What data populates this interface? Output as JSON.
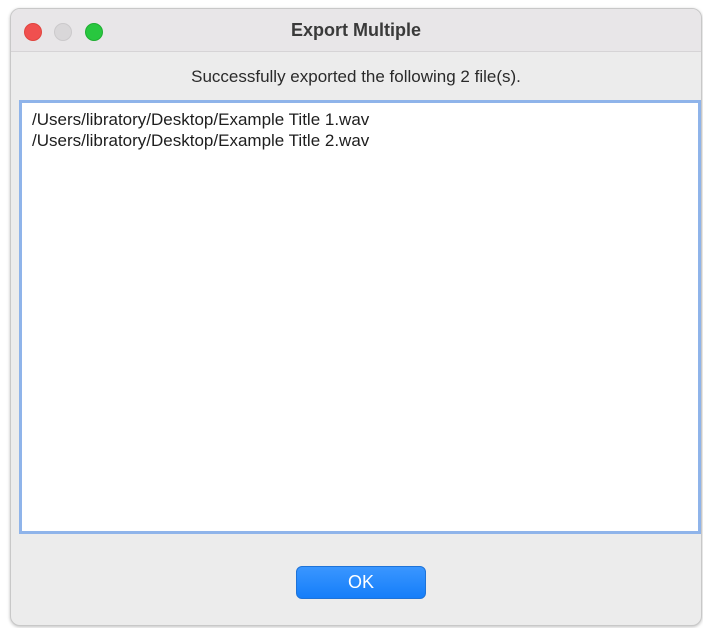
{
  "window": {
    "title": "Export Multiple"
  },
  "message": "Successfully exported the following 2 file(s).",
  "files": [
    "/Users/libratory/Desktop/Example Title 1.wav",
    "/Users/libratory/Desktop/Example Title 2.wav"
  ],
  "buttons": {
    "ok_label": "OK"
  },
  "icons": {
    "close": "close-button-icon",
    "minimize": "minimize-button-icon",
    "zoom": "zoom-button-icon"
  },
  "colors": {
    "close": "#f0504f",
    "minimize": "#d9d7d9",
    "zoom": "#28c73f",
    "accent": "#157ef9",
    "focus_ring": "#8fb4ea"
  }
}
